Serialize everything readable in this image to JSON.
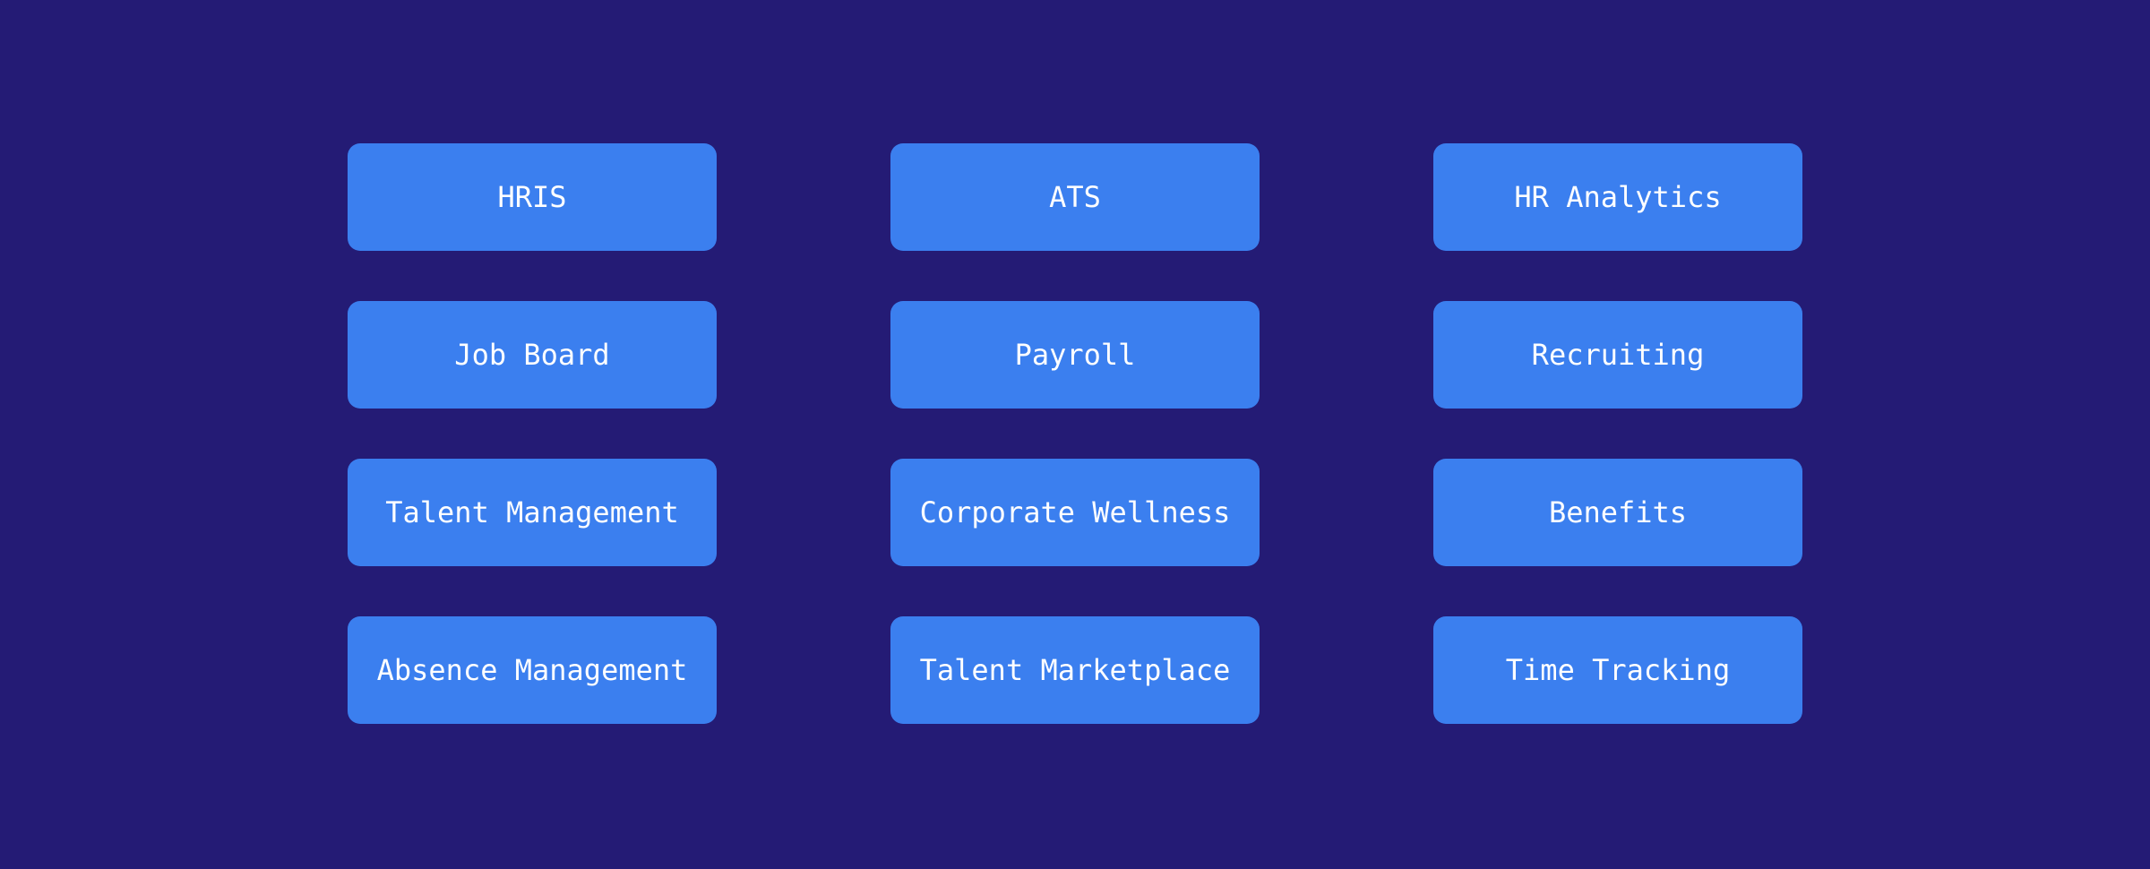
{
  "page": {
    "background_color": "#241b75",
    "card_color": "#3b7fef",
    "card_text_color": "#ffffff",
    "columns": 3,
    "rows": 4
  },
  "cards": [
    {
      "label": "HRIS"
    },
    {
      "label": "ATS"
    },
    {
      "label": "HR Analytics"
    },
    {
      "label": "Job Board"
    },
    {
      "label": "Payroll"
    },
    {
      "label": "Recruiting"
    },
    {
      "label": "Talent Management"
    },
    {
      "label": "Corporate Wellness"
    },
    {
      "label": "Benefits"
    },
    {
      "label": "Absence Management"
    },
    {
      "label": "Talent Marketplace"
    },
    {
      "label": "Time Tracking"
    }
  ]
}
